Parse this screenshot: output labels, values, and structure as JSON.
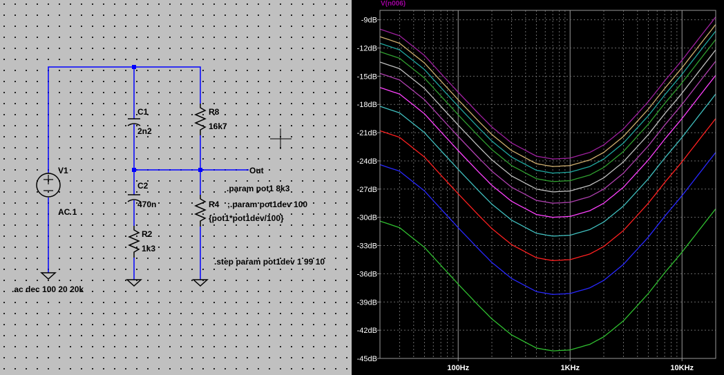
{
  "schematic": {
    "components": {
      "v1": {
        "name": "V1",
        "value": "AC 1"
      },
      "c1": {
        "name": "C1",
        "value": "2n2"
      },
      "c2": {
        "name": "C2",
        "value": "470n"
      },
      "r2": {
        "name": "R2",
        "value": "1k3"
      },
      "r8": {
        "name": "R8",
        "value": "16k7"
      },
      "r4": {
        "name": "R4",
        "value": "{pot1*pot1dev/100}"
      }
    },
    "out_label": "Out",
    "directives": {
      "param_pot1": ".param pot1 8k3",
      "param_pot1dev": ";.param pot1dev 100",
      "step": ".step param pot1dev 1 99 10",
      "ac": ".ac dec 100 20 20k"
    },
    "colors": {
      "background": "#c0c0c0",
      "wire": "#0000ff",
      "junction": "#0000ff",
      "text": "#000000"
    }
  },
  "plot": {
    "trace_label": "V(n006)",
    "colors": {
      "background": "#000000",
      "grid": "#7f7f7f",
      "axis_text": "#ffffff",
      "trace_label": "#a000a0"
    }
  },
  "chart_data": {
    "type": "line",
    "title": "V(n006)",
    "xscale": "log",
    "xlim": [
      20,
      20000
    ],
    "ylim": [
      -45,
      -8
    ],
    "grid": true,
    "x_tick_labels": [
      "100Hz",
      "1KHz",
      "10KHz"
    ],
    "y_tick_labels": [
      "-9dB",
      "-12dB",
      "-15dB",
      "-18dB",
      "-21dB",
      "-24dB",
      "-27dB",
      "-30dB",
      "-33dB",
      "-36dB",
      "-39dB",
      "-42dB",
      "-45dB"
    ],
    "x": [
      20,
      30,
      50,
      70,
      100,
      150,
      200,
      300,
      500,
      700,
      1000,
      1500,
      2000,
      3000,
      5000,
      7000,
      10000,
      15000,
      20000
    ],
    "series": [
      {
        "color": "#a020a0",
        "values": [
          -10.0,
          -10.7,
          -12.8,
          -14.7,
          -16.7,
          -18.9,
          -20.4,
          -22.1,
          -23.5,
          -23.8,
          -23.7,
          -23.1,
          -22.3,
          -20.6,
          -17.7,
          -15.5,
          -13.3,
          -10.6,
          -8.7
        ]
      },
      {
        "color": "#d0b070",
        "values": [
          -10.8,
          -11.5,
          -13.6,
          -15.5,
          -17.5,
          -19.7,
          -21.2,
          -22.9,
          -24.3,
          -24.6,
          -24.5,
          -23.9,
          -23.1,
          -21.4,
          -18.5,
          -16.3,
          -14.1,
          -11.4,
          -9.5
        ]
      },
      {
        "color": "#20a8a0",
        "values": [
          -11.5,
          -12.2,
          -14.3,
          -16.2,
          -18.2,
          -20.4,
          -21.9,
          -23.6,
          -25.0,
          -25.3,
          -25.2,
          -24.6,
          -23.8,
          -22.1,
          -19.2,
          -17.0,
          -14.8,
          -12.1,
          -10.2
        ]
      },
      {
        "color": "#30a030",
        "values": [
          -12.4,
          -13.1,
          -15.2,
          -17.1,
          -19.1,
          -21.3,
          -22.8,
          -24.5,
          -25.9,
          -26.2,
          -26.1,
          -25.5,
          -24.7,
          -23.0,
          -20.1,
          -17.9,
          -15.7,
          -13.0,
          -11.1
        ]
      },
      {
        "color": "#c0c0c0",
        "values": [
          -13.5,
          -14.2,
          -16.3,
          -18.2,
          -20.2,
          -22.4,
          -23.9,
          -25.6,
          -27.0,
          -27.3,
          -27.2,
          -26.6,
          -25.8,
          -24.1,
          -21.2,
          -19.0,
          -16.8,
          -14.1,
          -12.2
        ]
      },
      {
        "color": "#b040b0",
        "values": [
          -14.7,
          -15.4,
          -17.5,
          -19.4,
          -21.4,
          -23.6,
          -25.1,
          -26.8,
          -28.2,
          -28.5,
          -28.4,
          -27.8,
          -27.0,
          -25.3,
          -22.4,
          -20.2,
          -18.0,
          -15.3,
          -13.4
        ]
      },
      {
        "color": "#ff40ff",
        "values": [
          -16.2,
          -16.9,
          -19.0,
          -20.9,
          -22.9,
          -25.1,
          -26.6,
          -28.3,
          -29.7,
          -30.0,
          -29.9,
          -29.3,
          -28.5,
          -26.8,
          -23.9,
          -21.7,
          -19.5,
          -16.8,
          -14.9
        ]
      },
      {
        "color": "#40c0c0",
        "values": [
          -18.2,
          -18.9,
          -21.0,
          -22.9,
          -24.9,
          -27.1,
          -28.6,
          -30.3,
          -31.7,
          -32.0,
          -31.9,
          -31.3,
          -30.5,
          -28.8,
          -25.9,
          -23.7,
          -21.5,
          -18.8,
          -16.9
        ]
      },
      {
        "color": "#ff2020",
        "values": [
          -20.8,
          -21.5,
          -23.6,
          -25.5,
          -27.5,
          -29.7,
          -31.2,
          -32.9,
          -34.3,
          -34.6,
          -34.5,
          -33.9,
          -33.1,
          -31.4,
          -28.5,
          -26.3,
          -24.1,
          -21.4,
          -19.5
        ]
      },
      {
        "color": "#2828ff",
        "values": [
          -24.4,
          -25.1,
          -27.2,
          -29.1,
          -31.1,
          -33.3,
          -34.8,
          -36.5,
          -37.9,
          -38.2,
          -38.1,
          -37.5,
          -36.7,
          -35.0,
          -32.1,
          -29.9,
          -27.7,
          -25.0,
          -23.1
        ]
      },
      {
        "color": "#30c030",
        "values": [
          -30.4,
          -31.1,
          -33.2,
          -35.1,
          -37.1,
          -39.3,
          -40.8,
          -42.5,
          -43.9,
          -44.2,
          -44.1,
          -43.5,
          -42.7,
          -41.0,
          -38.1,
          -35.9,
          -33.7,
          -31.0,
          -29.1
        ]
      }
    ]
  }
}
